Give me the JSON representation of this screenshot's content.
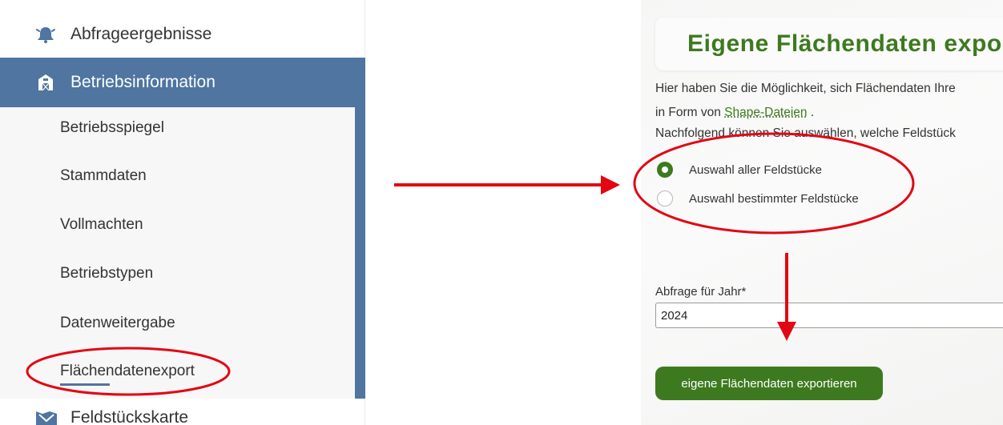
{
  "sidebar": {
    "top_item": {
      "label": "Abfrageergebnisse",
      "icon": "bell-icon"
    },
    "active_section": {
      "label": "Betriebsinformation",
      "icon": "farm-icon"
    },
    "sub_items": [
      "Betriebsspiegel",
      "Stammdaten",
      "Vollmachten",
      "Betriebstypen",
      "Datenweitergabe",
      "Flächendatenexport"
    ],
    "selected_sub_item": "Flächendatenexport",
    "bottom_item": {
      "label": "Feldstückskarte",
      "icon": "map-icon"
    }
  },
  "main": {
    "title": "Eigene Flächendaten export",
    "intro_line1": "Hier haben Sie die Möglichkeit, sich Flächendaten Ihre",
    "intro_line2_prefix": "in Form von ",
    "intro_link": "Shape-Dateien",
    "intro_line2_suffix": " .",
    "intro_line3": "Nachfolgend können Sie auswählen, welche Feldstück",
    "options": [
      {
        "label": "Auswahl aller Feldstücke",
        "checked": true
      },
      {
        "label": "Auswahl bestimmter Feldstücke",
        "checked": false
      }
    ],
    "year_label": "Abfrage für Jahr*",
    "year_value": "2024",
    "export_button": "eigene Flächendaten exportieren"
  },
  "colors": {
    "sidebar_accent": "#4f75a0",
    "primary_green": "#3d7a1f",
    "annotation_red": "#e30613"
  }
}
